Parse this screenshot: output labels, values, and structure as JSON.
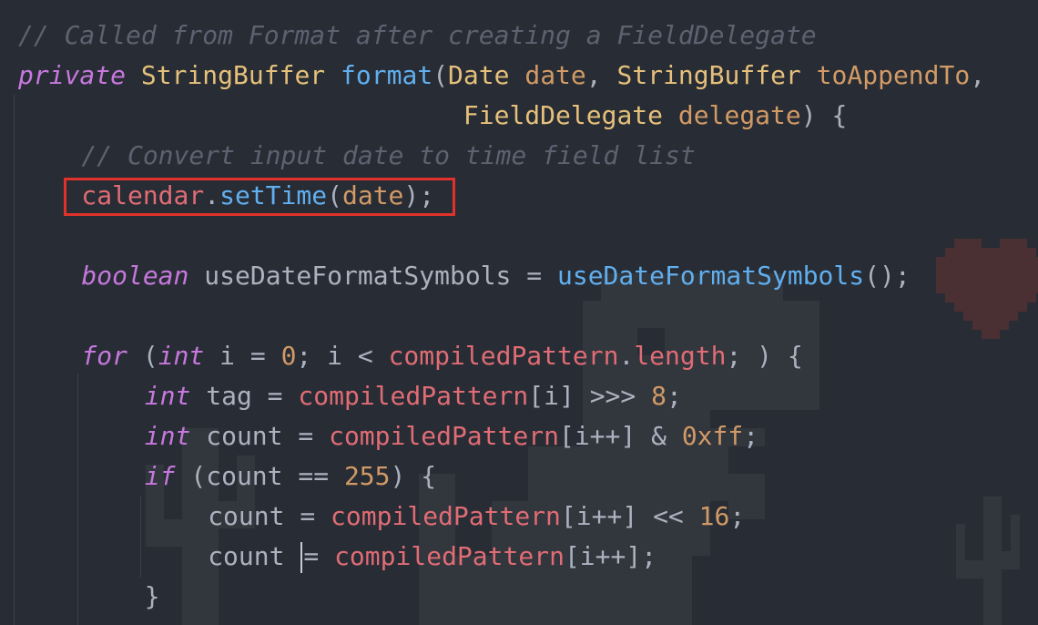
{
  "editor": {
    "background": "#282c34",
    "highlight_color": "#e0322b",
    "lines": [
      {
        "indent": 0,
        "tokens": [
          {
            "t": "cmt",
            "v": "// Called from Format after creating a FieldDelegate"
          }
        ]
      },
      {
        "indent": 0,
        "tokens": [
          {
            "t": "kw",
            "v": "private"
          },
          {
            "t": "plain",
            "v": " "
          },
          {
            "t": "type",
            "v": "StringBuffer"
          },
          {
            "t": "plain",
            "v": " "
          },
          {
            "t": "fn",
            "v": "format"
          },
          {
            "t": "plain",
            "v": "("
          },
          {
            "t": "type",
            "v": "Date"
          },
          {
            "t": "plain",
            "v": " "
          },
          {
            "t": "param",
            "v": "date"
          },
          {
            "t": "plain",
            "v": ", "
          },
          {
            "t": "type",
            "v": "StringBuffer"
          },
          {
            "t": "plain",
            "v": " "
          },
          {
            "t": "param",
            "v": "toAppendTo"
          },
          {
            "t": "plain",
            "v": ","
          }
        ]
      },
      {
        "indent": 0,
        "tokens": [
          {
            "t": "plain",
            "v": "                             "
          },
          {
            "t": "type",
            "v": "FieldDelegate"
          },
          {
            "t": "plain",
            "v": " "
          },
          {
            "t": "param",
            "v": "delegate"
          },
          {
            "t": "plain",
            "v": ") {"
          }
        ]
      },
      {
        "indent": 4,
        "tokens": [
          {
            "t": "cmt",
            "v": "// Convert input date to time field list"
          }
        ]
      },
      {
        "indent": 4,
        "tokens": [
          {
            "t": "field",
            "v": "calendar"
          },
          {
            "t": "plain",
            "v": "."
          },
          {
            "t": "fn",
            "v": "setTime"
          },
          {
            "t": "plain",
            "v": "("
          },
          {
            "t": "param",
            "v": "date"
          },
          {
            "t": "plain",
            "v": ");"
          }
        ]
      },
      {
        "indent": 0,
        "tokens": []
      },
      {
        "indent": 4,
        "tokens": [
          {
            "t": "kw",
            "v": "boolean"
          },
          {
            "t": "plain",
            "v": " useDateFormatSymbols = "
          },
          {
            "t": "fn",
            "v": "useDateFormatSymbols"
          },
          {
            "t": "plain",
            "v": "();"
          }
        ]
      },
      {
        "indent": 0,
        "tokens": []
      },
      {
        "indent": 4,
        "tokens": [
          {
            "t": "kw",
            "v": "for"
          },
          {
            "t": "plain",
            "v": " ("
          },
          {
            "t": "kw",
            "v": "int"
          },
          {
            "t": "plain",
            "v": " i = "
          },
          {
            "t": "num",
            "v": "0"
          },
          {
            "t": "plain",
            "v": "; i < "
          },
          {
            "t": "field",
            "v": "compiledPattern"
          },
          {
            "t": "plain",
            "v": "."
          },
          {
            "t": "field",
            "v": "length"
          },
          {
            "t": "plain",
            "v": "; ) {"
          }
        ]
      },
      {
        "indent": 8,
        "tokens": [
          {
            "t": "kw",
            "v": "int"
          },
          {
            "t": "plain",
            "v": " tag = "
          },
          {
            "t": "field",
            "v": "compiledPattern"
          },
          {
            "t": "plain",
            "v": "[i] >>> "
          },
          {
            "t": "num",
            "v": "8"
          },
          {
            "t": "plain",
            "v": ";"
          }
        ]
      },
      {
        "indent": 8,
        "tokens": [
          {
            "t": "kw",
            "v": "int"
          },
          {
            "t": "plain",
            "v": " count = "
          },
          {
            "t": "field",
            "v": "compiledPattern"
          },
          {
            "t": "plain",
            "v": "[i++] & "
          },
          {
            "t": "num",
            "v": "0xff"
          },
          {
            "t": "plain",
            "v": ";"
          }
        ]
      },
      {
        "indent": 8,
        "tokens": [
          {
            "t": "kw",
            "v": "if"
          },
          {
            "t": "plain",
            "v": " (count == "
          },
          {
            "t": "num",
            "v": "255"
          },
          {
            "t": "plain",
            "v": ") {"
          }
        ]
      },
      {
        "indent": 12,
        "tokens": [
          {
            "t": "plain",
            "v": "count = "
          },
          {
            "t": "field",
            "v": "compiledPattern"
          },
          {
            "t": "plain",
            "v": "[i++] << "
          },
          {
            "t": "num",
            "v": "16"
          },
          {
            "t": "plain",
            "v": ";"
          }
        ]
      },
      {
        "indent": 12,
        "tokens": [
          {
            "t": "plain",
            "v": "count "
          },
          {
            "t": "caret",
            "v": ""
          },
          {
            "t": "plain",
            "v": "= "
          },
          {
            "t": "field",
            "v": "compiledPattern"
          },
          {
            "t": "plain",
            "v": "[i++];"
          }
        ]
      },
      {
        "indent": 8,
        "tokens": [
          {
            "t": "plain",
            "v": "}"
          }
        ]
      }
    ]
  },
  "decorations": {
    "heart_icon": "heart-icon",
    "dino_icon": "dinosaur-icon",
    "cactus_icon": "cactus-icon"
  }
}
